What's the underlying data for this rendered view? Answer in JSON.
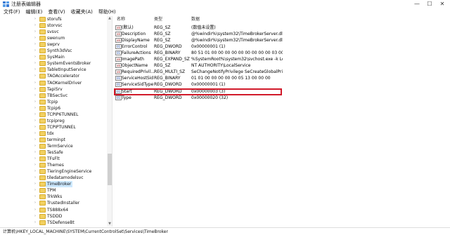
{
  "window": {
    "title": "注册表编辑器",
    "minimize_glyph": "—",
    "maximize_glyph": "☐",
    "close_glyph": "✕"
  },
  "menu": [
    {
      "label": "文件(F)"
    },
    {
      "label": "编辑(E)"
    },
    {
      "label": "查看(V)"
    },
    {
      "label": "收藏夹(A)"
    },
    {
      "label": "帮助(H)"
    }
  ],
  "tree": {
    "nodes": [
      {
        "label": "storufs"
      },
      {
        "label": "storvsc"
      },
      {
        "label": "svsvc"
      },
      {
        "label": "swenum"
      },
      {
        "label": "swprv"
      },
      {
        "label": "Synth3dVsc"
      },
      {
        "label": "SysMain"
      },
      {
        "label": "SystemEventsBroker"
      },
      {
        "label": "TabletInputService"
      },
      {
        "label": "TAOAccelerator"
      },
      {
        "label": "TAOKernelDriver"
      },
      {
        "label": "TapiSrv"
      },
      {
        "label": "TBSecSvc"
      },
      {
        "label": "Tcpip"
      },
      {
        "label": "Tcpip6"
      },
      {
        "label": "TCPIP6TUNNEL"
      },
      {
        "label": "tcpipreg"
      },
      {
        "label": "TCPIPTUNNEL"
      },
      {
        "label": "tdx"
      },
      {
        "label": "terminpt"
      },
      {
        "label": "TermService"
      },
      {
        "label": "TesSafe"
      },
      {
        "label": "TFsFlt"
      },
      {
        "label": "Themes"
      },
      {
        "label": "TieringEngineService"
      },
      {
        "label": "tiledatamodelsvc"
      },
      {
        "label": "TimeBroker",
        "selected": true
      },
      {
        "label": "TPM"
      },
      {
        "label": "TrkWks"
      },
      {
        "label": "TrustedInstaller"
      },
      {
        "label": "TS888x64"
      },
      {
        "label": "TSDDD"
      },
      {
        "label": "TSDefenseBt"
      }
    ]
  },
  "values_pane": {
    "headers": {
      "name": "名称",
      "type": "类型",
      "data": "数据"
    },
    "rows": [
      {
        "name": "(默认)",
        "type": "REG_SZ",
        "data": "(数值未设置)",
        "icon": "string-value-icon",
        "kind": "sz"
      },
      {
        "name": "Description",
        "type": "REG_SZ",
        "data": "@%windir%\\system32\\TimeBrokerServer.dll,-...",
        "icon": "string-value-icon",
        "kind": "sz"
      },
      {
        "name": "DisplayName",
        "type": "REG_SZ",
        "data": "@%windir%\\system32\\TimeBrokerServer.dll,-...",
        "icon": "string-value-icon",
        "kind": "sz"
      },
      {
        "name": "ErrorControl",
        "type": "REG_DWORD",
        "data": "0x00000001 (1)",
        "icon": "binary-value-icon",
        "kind": "dword"
      },
      {
        "name": "FailureActions",
        "type": "REG_BINARY",
        "data": "80 51 01 00 00 00 00 00 00 00 00 00 03 00 0...",
        "icon": "binary-value-icon",
        "kind": "dword"
      },
      {
        "name": "ImagePath",
        "type": "REG_EXPAND_SZ",
        "data": "%SystemRoot%\\system32\\svchost.exe -k Loc...",
        "icon": "string-value-icon",
        "kind": "sz"
      },
      {
        "name": "ObjectName",
        "type": "REG_SZ",
        "data": "NT AUTHORITY\\LocalService",
        "icon": "string-value-icon",
        "kind": "sz"
      },
      {
        "name": "RequiredPrivil...",
        "type": "REG_MULTI_SZ",
        "data": "SeChangeNotifyPrivilege SeCreateGlobalPrivi...",
        "icon": "string-value-icon",
        "kind": "sz"
      },
      {
        "name": "ServiceHostSid",
        "type": "REG_BINARY",
        "data": "01 01 00 00 00 00 00 05 13 00 00 00",
        "icon": "binary-value-icon",
        "kind": "dword"
      },
      {
        "name": "ServiceSidType",
        "type": "REG_DWORD",
        "data": "0x00000001 (1)",
        "icon": "binary-value-icon",
        "kind": "dword"
      },
      {
        "name": "Start",
        "type": "REG_DWORD",
        "data": "0x00000003 (3)",
        "icon": "binary-value-icon",
        "kind": "dword"
      },
      {
        "name": "Type",
        "type": "REG_DWORD",
        "data": "0x00000020 (32)",
        "icon": "binary-value-icon",
        "kind": "dword"
      }
    ]
  },
  "status": {
    "path": "计算机\\HKEY_LOCAL_MACHINE\\SYSTEM\\CurrentControlSet\\Services\\TimeBroker"
  },
  "colors": {
    "selection": "#cce8ff",
    "highlight_border": "#d11a2a",
    "folder": "#f2d061"
  }
}
